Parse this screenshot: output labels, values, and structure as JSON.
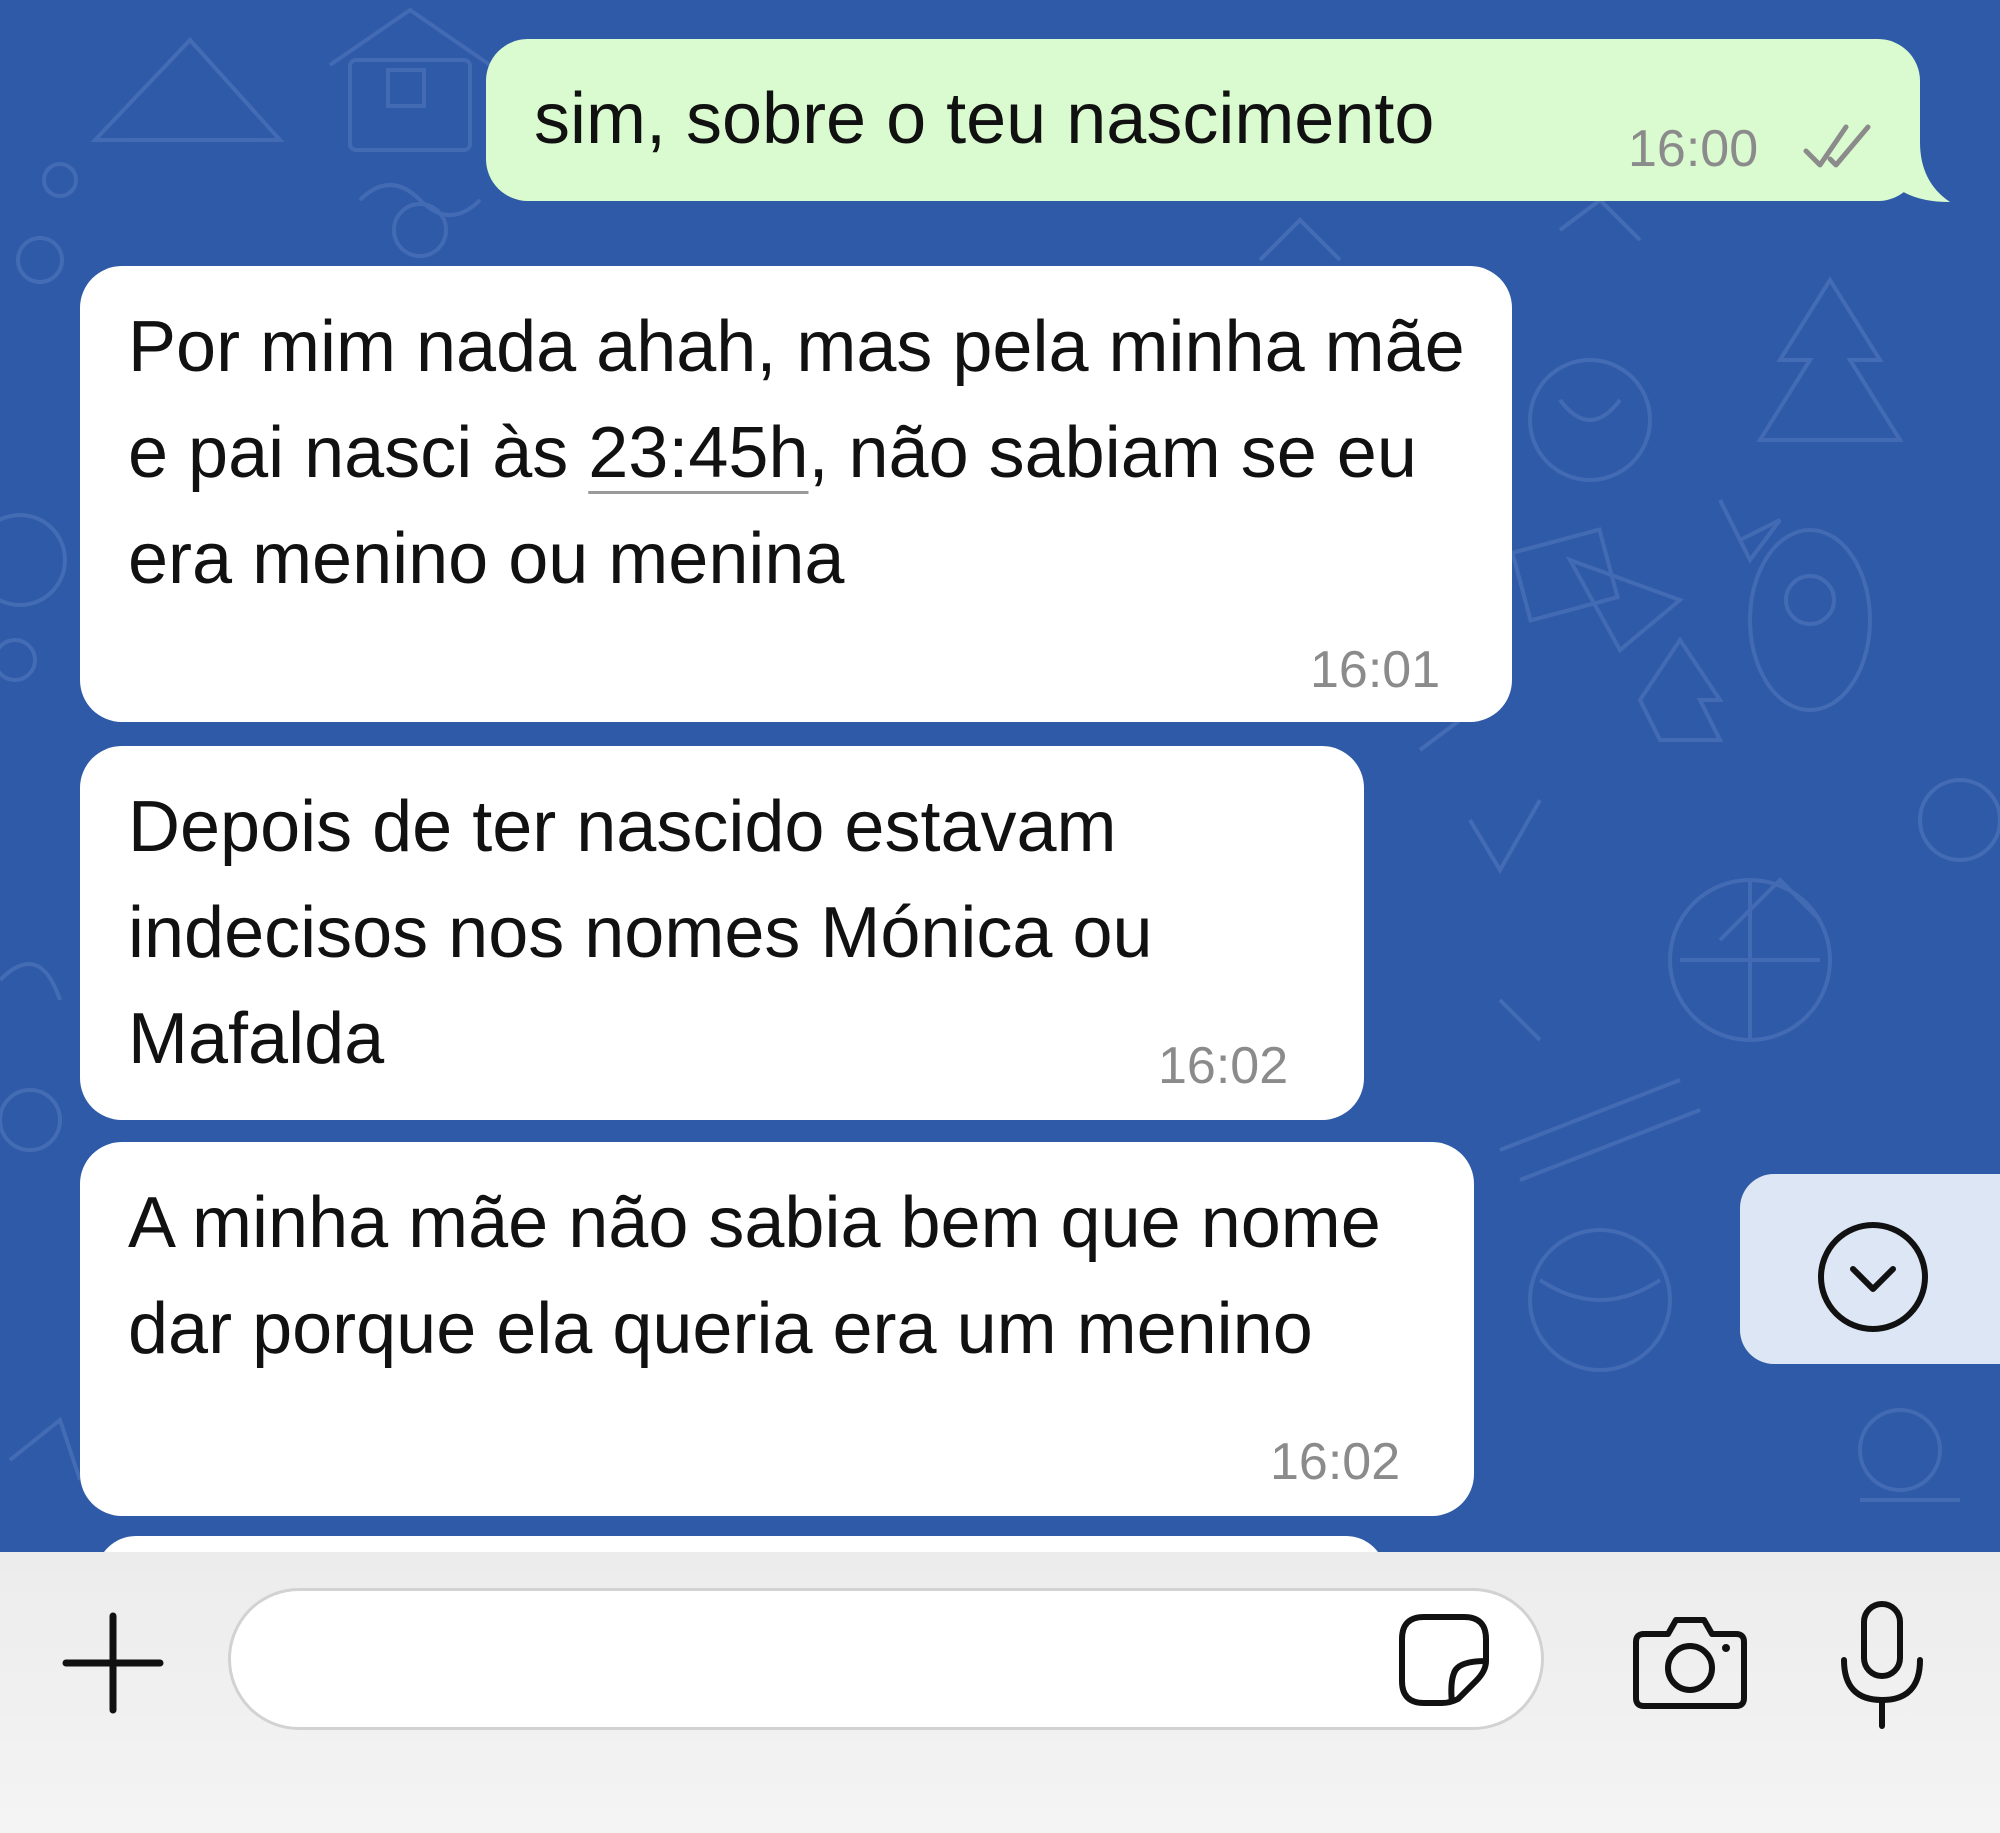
{
  "messages": [
    {
      "direction": "outgoing",
      "text": "sim, sobre o teu nascimento",
      "time": "16:00",
      "status_icon": "double-check-icon"
    },
    {
      "direction": "incoming",
      "text_before_link": "Por mim nada ahah, mas pela minha mãe e pai nasci às ",
      "link_text": "23:45h",
      "text_after_link": ", não sabiam se eu era menino ou menina",
      "time": "16:01"
    },
    {
      "direction": "incoming",
      "text": "Depois de ter nascido estavam indecisos nos nomes Mónica ou Mafalda",
      "time": "16:02"
    },
    {
      "direction": "incoming",
      "text": "A minha mãe não sabia bem que nome dar porque ela queria era um menino",
      "time": "16:02"
    }
  ],
  "scroll_button": {
    "icon": "chevron-down-circle-icon"
  },
  "input_bar": {
    "placeholder": "",
    "value": "",
    "icons": [
      "plus-icon",
      "sticker-icon",
      "camera-icon",
      "microphone-icon"
    ]
  },
  "colors": {
    "wallpaper": "#2f5aa8",
    "outgoing_bubble": "#dafbd0",
    "incoming_bubble": "#ffffff",
    "timestamp": "#8b8b8b",
    "scroll_button_bg": "#dce6f5",
    "input_bar_bg": "#f0f0f0"
  }
}
